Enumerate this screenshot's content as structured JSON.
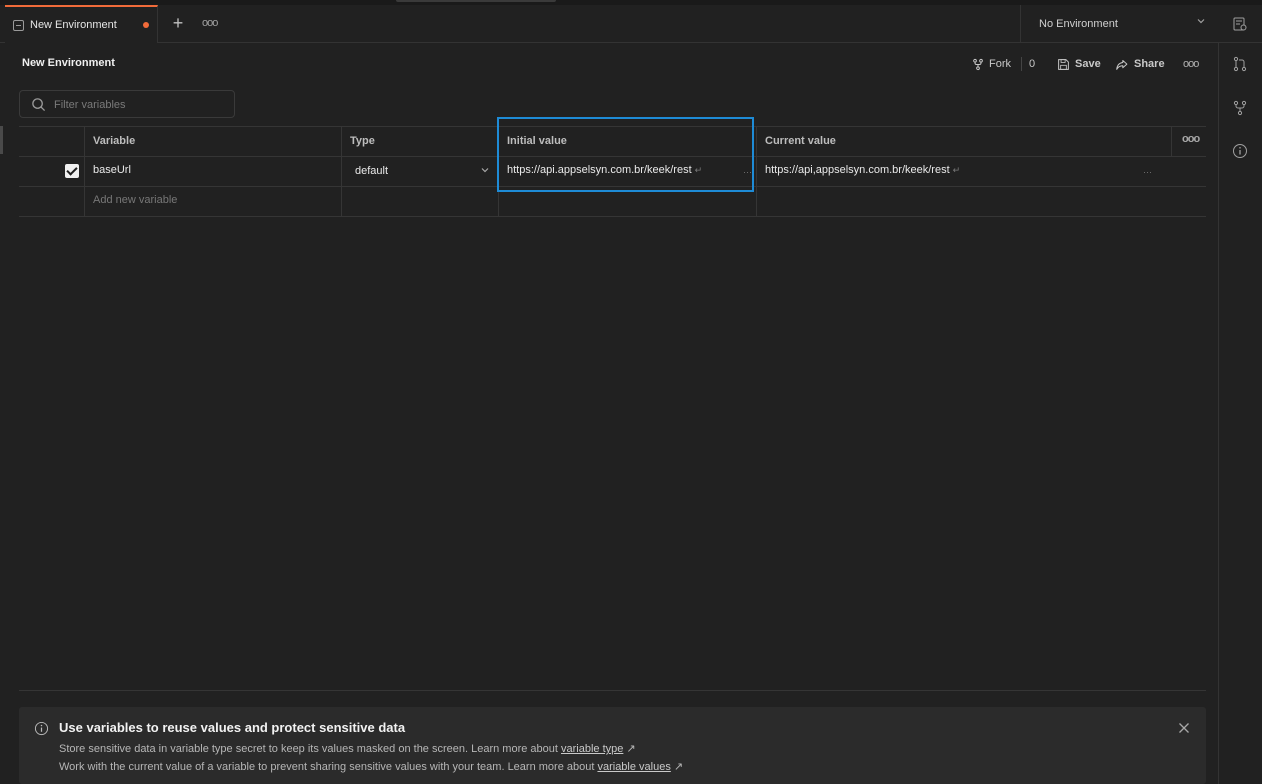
{
  "tabs": [
    {
      "label": "New Environment",
      "unsaved": true
    }
  ],
  "tab_actions": {
    "new_tab": "+",
    "more": "ooo"
  },
  "environment_selector": {
    "selected": "No Environment"
  },
  "header": {
    "title": "New Environment",
    "fork_label": "Fork",
    "fork_count": "0",
    "save_label": "Save",
    "share_label": "Share",
    "more": "ooo"
  },
  "filter": {
    "placeholder": "Filter variables"
  },
  "table": {
    "columns": [
      "Variable",
      "Type",
      "Initial value",
      "Current value"
    ],
    "more": "ooo",
    "rows": [
      {
        "enabled": true,
        "variable": "baseUrl",
        "type": "default",
        "initial_value": "https://api.appselsyn.com.br/keek/rest",
        "current_value": "https://api,appselsyn.com.br/keek/rest"
      }
    ],
    "add_placeholder": "Add new variable"
  },
  "banner": {
    "heading": "Use variables to reuse values and protect sensitive data",
    "line1_text": "Store sensitive data in variable type secret to keep its values masked on the screen. Learn more about ",
    "line1_link": "variable type",
    "line2_text": "Work with the current value of a variable to prevent sharing sensitive values with your team. Learn more about ",
    "line2_link": "variable values"
  },
  "colors": {
    "accent": "#f26b3a",
    "highlight": "#1e8bd6",
    "background": "#212121"
  }
}
